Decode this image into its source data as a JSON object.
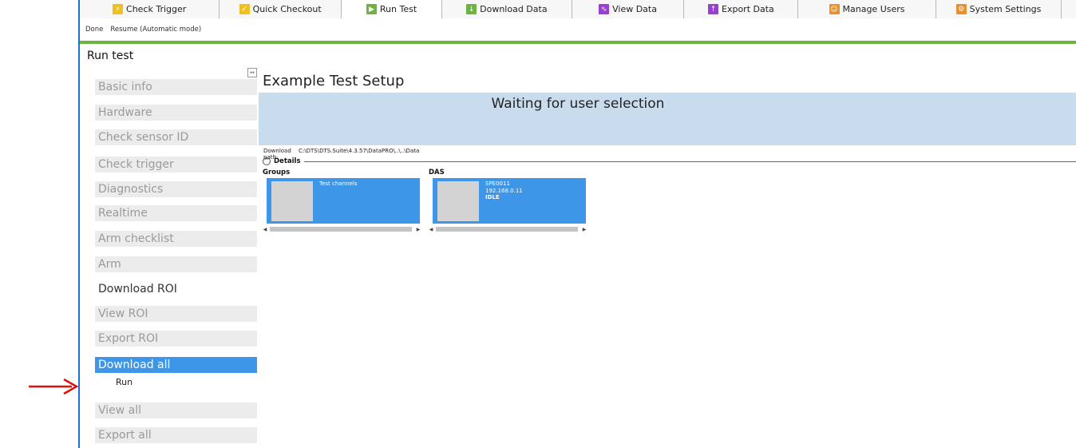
{
  "tabs": [
    {
      "label": "Check Trigger",
      "icon": "trigger-icon",
      "color": "#f2c01e"
    },
    {
      "label": "Quick Checkout",
      "icon": "checkout-icon",
      "color": "#f2c01e"
    },
    {
      "label": "Run Test",
      "icon": "run-test-icon",
      "color": "#6db33f"
    },
    {
      "label": "Download Data",
      "icon": "download-icon",
      "color": "#6db33f"
    },
    {
      "label": "View Data",
      "icon": "chart-icon",
      "color": "#9b3fd1"
    },
    {
      "label": "Export Data",
      "icon": "export-icon",
      "color": "#9b3fd1"
    },
    {
      "label": "Manage Users",
      "icon": "users-icon",
      "color": "#e8912c"
    },
    {
      "label": "System Settings",
      "icon": "settings-icon",
      "color": "#e8912c"
    }
  ],
  "toolbar": {
    "done_label": "Done",
    "resume_label": "Resume (Automatic mode)"
  },
  "page_title": "Run test",
  "steps": [
    {
      "label": "Basic info"
    },
    {
      "label": "Hardware"
    },
    {
      "label": "Check sensor ID"
    },
    {
      "label": "Check trigger"
    },
    {
      "label": "Diagnostics"
    },
    {
      "label": "Realtime"
    },
    {
      "label": "Arm checklist"
    },
    {
      "label": "Arm"
    },
    {
      "label": "Download ROI"
    },
    {
      "label": "View ROI"
    },
    {
      "label": "Export ROI"
    },
    {
      "label": "Download all"
    },
    {
      "label": "View all"
    },
    {
      "label": "Export all"
    }
  ],
  "substep": {
    "label": "Run"
  },
  "collapse_button": {
    "glyph": "↔"
  },
  "main": {
    "setup_title": "Example Test Setup",
    "status": "Waiting for user selection",
    "download_path_label": "Download path:",
    "download_path_value": "C:\\DTS\\DTS.Suite\\4.3.57\\DataPRO\\..\\..\\Data",
    "details_label": "Details",
    "details_toggle": "^"
  },
  "groups": {
    "label": "Groups",
    "cards": [
      {
        "lines": [
          "Test channels"
        ]
      }
    ]
  },
  "das": {
    "label": "DAS",
    "cards": [
      {
        "lines": [
          "SPE0011",
          "192.168.0.11"
        ],
        "status": "IDLE"
      }
    ]
  },
  "scroll": {
    "left_arrow": "◀",
    "right_arrow": "▶"
  },
  "colors": {
    "accent_green": "#6db33f",
    "selected_blue": "#3d96e8",
    "status_panel": "#c9dcee",
    "annotation_arrow": "#e01010"
  }
}
